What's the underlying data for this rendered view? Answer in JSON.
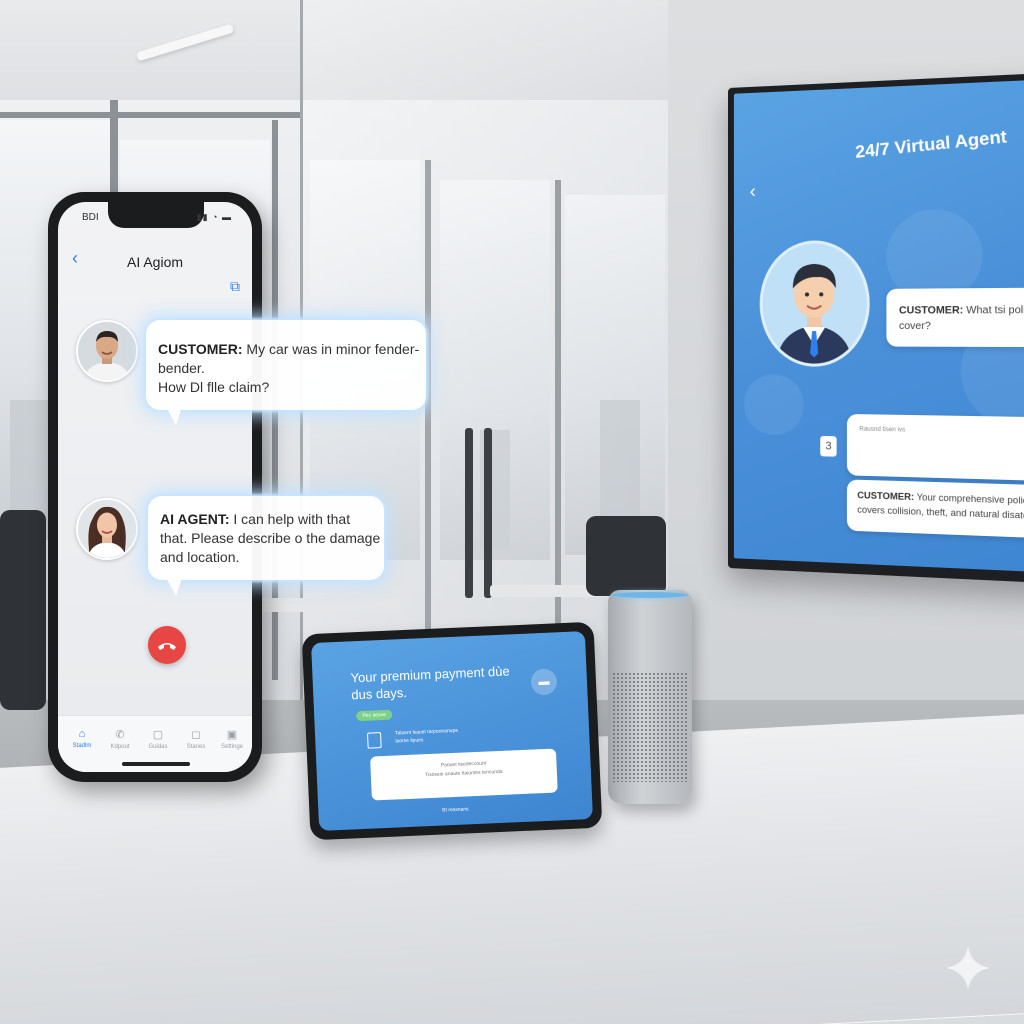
{
  "phone": {
    "status_time": "BDI",
    "status_icons": "▮▮ ◔ ▬",
    "back_icon": "‹",
    "title": "AI Agiom",
    "camera_icon": "⧉",
    "customer_message": {
      "speaker": "CUSTOMER:",
      "text_line1": "My car was in minor fender-bender.",
      "text_line2": "How Dl flle claim?"
    },
    "agent_message": {
      "speaker": "AI AGENT:",
      "text_line1": "I can help with that",
      "text_line2": "that. Please describe o the damage",
      "text_line3": "and location."
    },
    "tabs": [
      {
        "icon": "⌂",
        "label": "Stadlm"
      },
      {
        "icon": "✆",
        "label": "Kdpout"
      },
      {
        "icon": "▢",
        "label": "Guidas"
      },
      {
        "icon": "◻",
        "label": "Stanes"
      },
      {
        "icon": "▣",
        "label": "Settinge"
      }
    ]
  },
  "tv": {
    "title": "24/7 Virtual Agent",
    "back_icon": "‹",
    "bubble1": {
      "speaker": "CUSTOMER:",
      "text_line1": "What tsi policy",
      "text_line2": "cover?"
    },
    "chip": "3",
    "bubble2": {
      "header": "Rausnd tisen ivs",
      "corner": "O"
    },
    "bubble3": {
      "speaker": "CUSTOMER:",
      "text_line1": "Your comprehensive policy as",
      "text_line2": "covers collision, theft, and natural disatess a"
    }
  },
  "tablet": {
    "title_line1": "Your premium payment dùe",
    "title_line2": "dus days.",
    "icon": "▬",
    "pill": "Pec aeuxe",
    "row_line1": "Taloent lsauet tarpoonanupe",
    "row_line2": "laorse ilpues",
    "card_line1": "Paouet tisedeccount",
    "card_line2": "Tisoseie anaute ttaiuntes tencunda",
    "footer": "Bt ressnans"
  },
  "colors": {
    "accent_blue": "#4a90d9",
    "end_call_red": "#e84545",
    "tab_active_blue": "#2f80ed",
    "pill_green": "#7fd08a"
  }
}
